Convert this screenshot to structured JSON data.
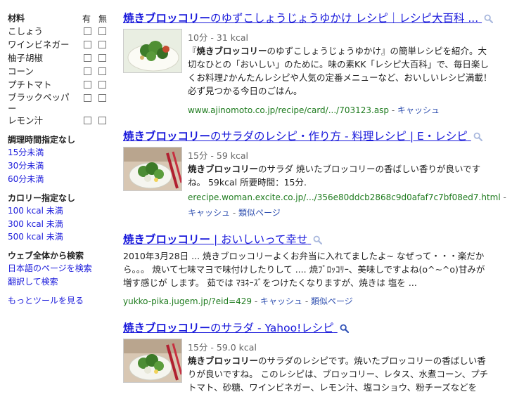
{
  "sidebar": {
    "ingredients_heading": "材料",
    "col_yes": "有",
    "col_no": "無",
    "ingredients": [
      "こしょう",
      "ワインビネガー",
      "柚子胡椒",
      "コーン",
      "プチトマト",
      "ブラックペッパー",
      "レモン汁"
    ],
    "time_heading": "調理時間指定なし",
    "time_links": [
      "15分未満",
      "30分未満",
      "60分未満"
    ],
    "calorie_heading": "カロリー指定なし",
    "calorie_links": [
      "100 kcal 未満",
      "300 kcal 未満",
      "500 kcal 未満"
    ],
    "web_heading": "ウェブ全体から検索",
    "web_links": [
      "日本語のページを検索",
      "翻訳して検索"
    ],
    "more_tools": "もっとツールを見る"
  },
  "results": [
    {
      "title_bold": "焼きブロッコリー",
      "title_rest": "のゆずこしょうじょうゆかけ レシピ｜レシピ大百科 ...",
      "meta": "10分 - 31 kcal",
      "snippet_lines": [
        "『焼きブロッコリーのゆずこしょうじょうゆかけ』の簡単レシピを紹介。大",
        "切なひとの「おいしい」のために。味の素KK「レシピ大百科」で、毎日楽し",
        "くお料理♪かんたんレシピや人気の定番メニューなど、おいしいレシピ満載！",
        "必ず見つかる今日のごはん。"
      ],
      "url": "www.ajinomoto.co.jp/recipe/card/.../703123.asp",
      "cache": "キャッシュ"
    },
    {
      "title_bold": "焼きブロッコリー",
      "title_rest": "のサラダのレシピ・作り方 - 料理レシピ | E・レシピ",
      "meta": "15分 - 59 kcal",
      "snippet_lines": [
        "焼きブロッコリーのサラダ 焼いたブロッコリーの香ばしい香りが良いです",
        "ね。 59kcal 所要時間：15分."
      ],
      "url": "erecipe.woman.excite.co.jp/.../356e80ddcb2868c9d0afaf7c7bf08ed7.html",
      "cache": "キャッシュ",
      "similar": "類似ページ"
    },
    {
      "title_bold": "焼きブロッコリー",
      "title_rest": " | おいしいって幸せ",
      "snippet_lines": [
        "2010年3月28日 ... 焼きブロッコリーよくお弁当に入れてましたよ~ なぜって・・・楽だか",
        "ら。。。 焼いて七味マヨで味付けしたりして .... 焼ﾌﾞﾛｯｺﾘｰ、美味しですよね(o^~^o)甘みが",
        "増す感じが します。 茹では ﾏﾖﾈｰｽﾞをつけたくなりますが、焼きは 塩を ..."
      ],
      "url": "yukko-pika.jugem.jp/?eid=429",
      "cache": "キャッシュ",
      "similar": "類似ページ"
    },
    {
      "title_bold": "焼きブロッコリー",
      "title_rest": "のサラダ - Yahoo!レシピ",
      "meta": "15分 - 59.0 kcal",
      "snippet_lines": [
        "焼きブロッコリーのサラダのレシピです。焼いたブロッコリーの香ばしい香",
        "りが良いですね。 このレシピは、ブロッコリー、レタス、水煮コーン、プチ",
        "トマト、砂糖、ワインビネガー、レモン汁、塩コショウ、粉チーズなどを"
      ]
    }
  ]
}
